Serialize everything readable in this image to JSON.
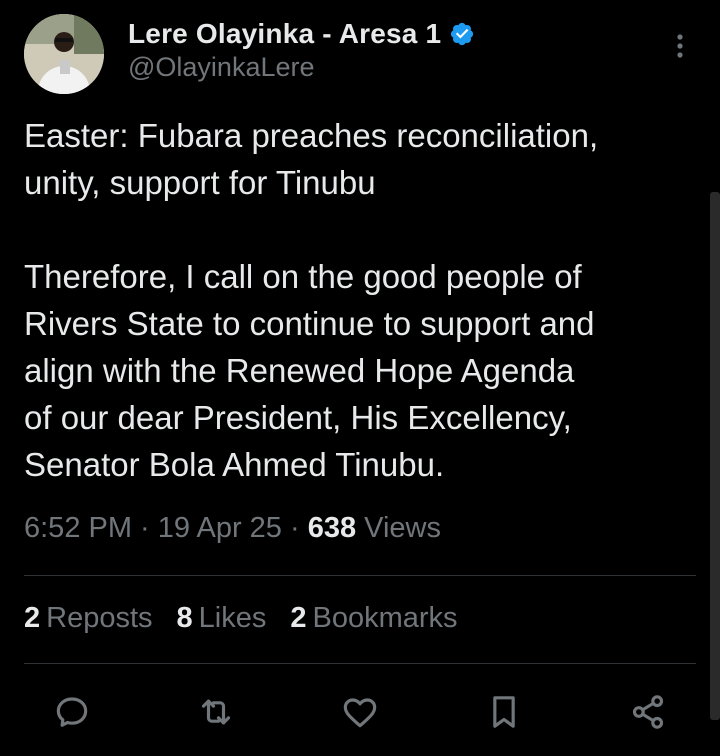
{
  "author": {
    "display_name": "Lere Olayinka - Aresa 1",
    "handle": "@OlayinkaLere",
    "verified": true,
    "avatar": "avatar"
  },
  "tweet": {
    "paragraph1": "Easter: Fubara preaches reconciliation,\nunity, support for Tinubu",
    "paragraph2": "Therefore, I call on the good people of\nRivers State to continue to support and\nalign with the Renewed Hope Agenda\nof our dear President, His Excellency,\nSenator Bola Ahmed Tinubu."
  },
  "meta": {
    "time": "6:52 PM",
    "sep1": " · ",
    "date": "19 Apr 25",
    "sep2": " · ",
    "views_count": "638",
    "views_label": "Views"
  },
  "stats": {
    "reposts_count": "2",
    "reposts_label": "Reposts",
    "likes_count": "8",
    "likes_label": "Likes",
    "bookmarks_count": "2",
    "bookmarks_label": "Bookmarks"
  },
  "actions": [
    "reply-icon",
    "repost-icon",
    "like-icon",
    "bookmark-icon",
    "share-icon"
  ],
  "colors": {
    "background": "#000000",
    "text": "#e7e9ea",
    "secondary": "#71767b",
    "divider": "#2f3336",
    "verified": "#1d9bf0"
  }
}
